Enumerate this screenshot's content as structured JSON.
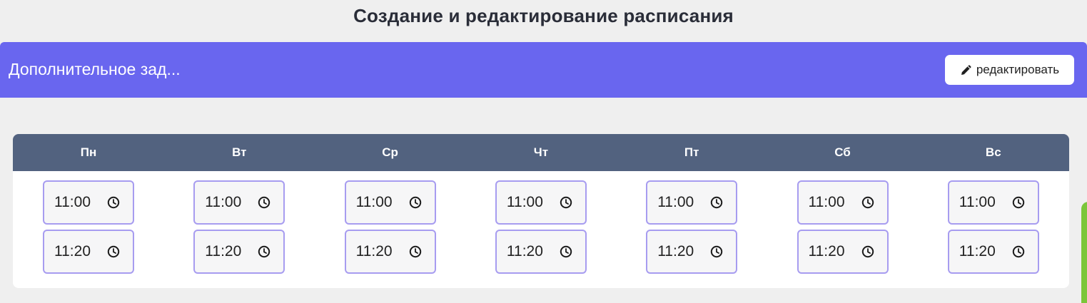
{
  "page": {
    "title": "Создание и редактирование расписания"
  },
  "banner": {
    "title": "Дополнительное зад...",
    "edit_label": "редактировать",
    "edit_icon": "pencil-icon",
    "color": "#6966ef"
  },
  "schedule": {
    "header_color": "#52627f",
    "input_border_color": "#a79cf0",
    "time_icon": "clock-icon",
    "days": [
      {
        "label": "Пн",
        "times": [
          "11:00",
          "11:20"
        ]
      },
      {
        "label": "Вт",
        "times": [
          "11:00",
          "11:20"
        ]
      },
      {
        "label": "Ср",
        "times": [
          "11:00",
          "11:20"
        ]
      },
      {
        "label": "Чт",
        "times": [
          "11:00",
          "11:20"
        ]
      },
      {
        "label": "Пт",
        "times": [
          "11:00",
          "11:20"
        ]
      },
      {
        "label": "Сб",
        "times": [
          "11:00",
          "11:20"
        ]
      },
      {
        "label": "Вс",
        "times": [
          "11:00",
          "11:20"
        ]
      }
    ]
  }
}
